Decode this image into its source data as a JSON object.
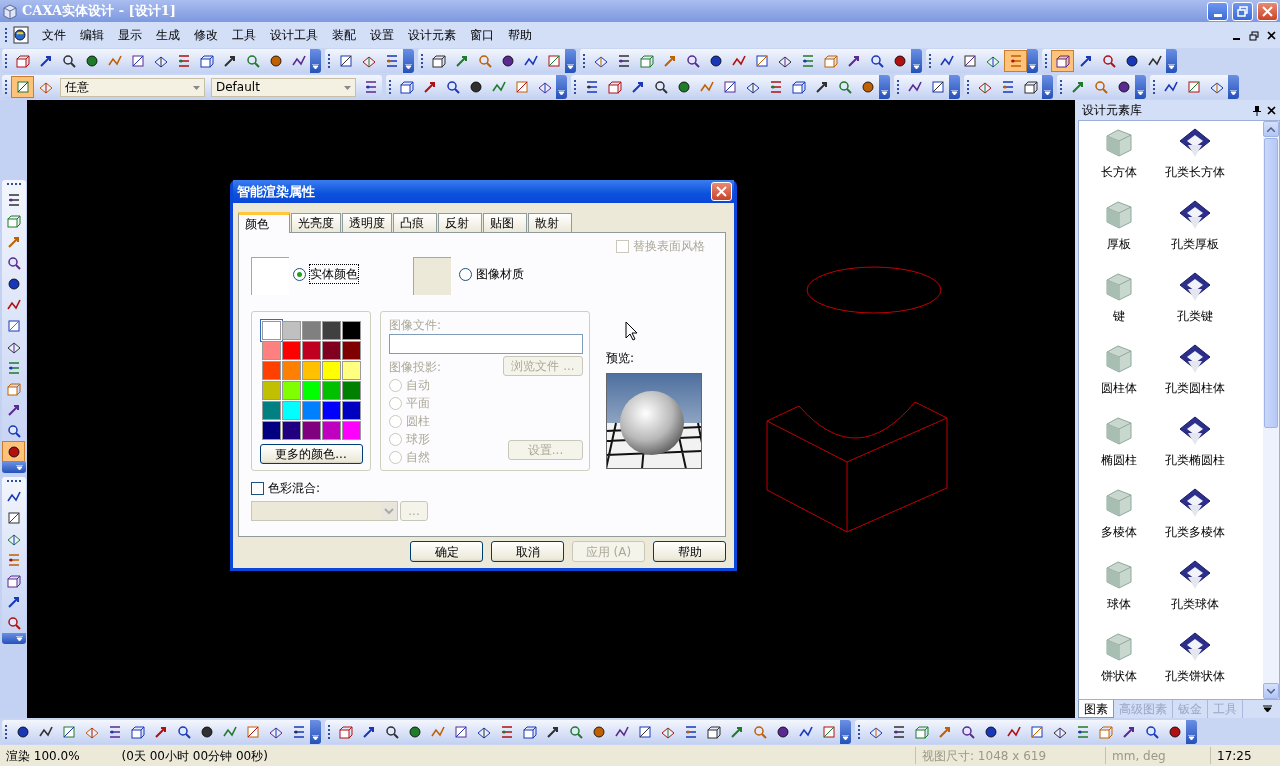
{
  "window": {
    "title": "CAXA实体设计 - [设计1]"
  },
  "menu": [
    "文件",
    "编辑",
    "显示",
    "生成",
    "修改",
    "工具",
    "设计工具",
    "装配",
    "设置",
    "设计元素",
    "窗口",
    "帮助"
  ],
  "toolbar_1": [
    {
      "buttons": [
        {
          "on": false
        },
        {
          "on": false
        },
        {
          "on": false
        },
        {
          "on": false
        },
        {
          "on": false
        },
        {
          "on": false
        },
        {
          "on": false
        },
        {
          "on": false
        },
        {
          "on": false
        },
        {
          "on": false
        },
        {
          "on": false
        },
        {
          "on": false
        },
        {
          "on": false
        }
      ]
    },
    {
      "buttons": [
        {
          "on": false
        },
        {
          "on": false
        },
        {
          "on": false
        }
      ]
    },
    {
      "buttons": [
        {
          "on": false
        },
        {
          "on": false
        },
        {
          "on": false
        },
        {
          "on": false
        },
        {
          "on": false
        },
        {
          "on": false
        }
      ]
    },
    {
      "buttons": [
        {
          "on": false
        },
        {
          "on": false
        },
        {
          "on": false
        },
        {
          "on": false
        },
        {
          "on": false
        },
        {
          "on": false
        },
        {
          "on": false
        },
        {
          "on": false
        },
        {
          "on": false
        },
        {
          "on": false
        },
        {
          "on": false
        },
        {
          "on": false
        },
        {
          "on": false
        },
        {
          "on": false
        }
      ]
    },
    {
      "buttons": [
        {
          "on": false
        },
        {
          "on": false
        },
        {
          "on": false
        },
        {
          "on": true
        }
      ]
    },
    {
      "buttons": [
        {
          "on": true
        },
        {
          "on": false
        },
        {
          "on": false
        },
        {
          "on": false
        },
        {
          "on": false
        }
      ]
    }
  ],
  "toolbar_2": {
    "start_buttons": [
      {
        "on": true
      },
      {
        "on": false
      }
    ],
    "selection_filter": "任意",
    "style": "Default",
    "end_buttons": [
      {
        "on": false
      }
    ],
    "groups": [
      {
        "buttons": [
          {
            "on": false
          },
          {
            "on": false
          },
          {
            "on": false
          },
          {
            "on": false
          },
          {
            "on": false
          },
          {
            "on": false
          },
          {
            "on": false
          }
        ]
      },
      {
        "buttons": [
          {
            "on": false
          },
          {
            "on": false
          },
          {
            "on": false
          },
          {
            "on": false
          },
          {
            "on": false
          },
          {
            "on": false
          },
          {
            "on": false
          },
          {
            "on": false
          },
          {
            "on": false
          },
          {
            "on": false
          },
          {
            "on": false
          },
          {
            "on": false
          },
          {
            "on": false
          }
        ]
      },
      {
        "buttons": [
          {
            "on": false
          },
          {
            "on": false
          }
        ]
      },
      {
        "buttons": [
          {
            "on": false
          },
          {
            "on": false
          },
          {
            "on": false
          }
        ]
      },
      {
        "buttons": [
          {
            "on": false
          },
          {
            "on": false
          },
          {
            "on": false
          }
        ]
      },
      {
        "buttons": [
          {
            "on": false
          },
          {
            "on": false
          },
          {
            "on": false
          }
        ]
      }
    ]
  },
  "left_toolbar": [
    {
      "buttons": [
        {
          "on": false
        },
        {
          "on": false
        },
        {
          "on": false
        },
        {
          "on": false
        },
        {
          "on": false
        },
        {
          "on": false
        },
        {
          "on": false
        },
        {
          "on": false
        },
        {
          "on": false
        },
        {
          "on": false
        },
        {
          "on": false
        },
        {
          "on": false
        },
        {
          "on": true
        }
      ]
    },
    {
      "buttons": [
        {
          "on": false
        },
        {
          "on": false
        },
        {
          "on": false
        },
        {
          "on": false
        },
        {
          "on": false
        },
        {
          "on": false
        },
        {
          "on": false
        }
      ]
    }
  ],
  "dialog": {
    "title": "智能渲染属性",
    "tabs": [
      {
        "label": "颜色",
        "selected": true
      },
      {
        "label": "光亮度",
        "selected": false
      },
      {
        "label": "透明度",
        "selected": false
      },
      {
        "label": "凸痕",
        "selected": false
      },
      {
        "label": "反射",
        "selected": false
      },
      {
        "label": "贴图",
        "selected": false
      },
      {
        "label": "散射",
        "selected": false
      }
    ],
    "replace_surface_style": {
      "label": "替换表面风格",
      "checked": false,
      "disabled": true
    },
    "color_source": [
      {
        "label": "实体颜色",
        "selected": true,
        "color": "#ffffff"
      },
      {
        "label": "图像材质",
        "selected": false,
        "color": "#ece9d8"
      }
    ],
    "palette": {
      "colors": [
        {
          "color": "#ffffff",
          "selected": true
        },
        {
          "color": "#c0c0c0",
          "selected": false
        },
        {
          "color": "#808080",
          "selected": false
        },
        {
          "color": "#404040",
          "selected": false
        },
        {
          "color": "#000000",
          "selected": false
        },
        {
          "color": "#ff8080",
          "selected": false
        },
        {
          "color": "#ff0000",
          "selected": false
        },
        {
          "color": "#c00020",
          "selected": false
        },
        {
          "color": "#800020",
          "selected": false
        },
        {
          "color": "#800000",
          "selected": false
        },
        {
          "color": "#ff4000",
          "selected": false
        },
        {
          "color": "#ff8000",
          "selected": false
        },
        {
          "color": "#ffc000",
          "selected": false
        },
        {
          "color": "#ffff00",
          "selected": false
        },
        {
          "color": "#ffff80",
          "selected": false
        },
        {
          "color": "#c0c000",
          "selected": false
        },
        {
          "color": "#80ff00",
          "selected": false
        },
        {
          "color": "#00ff00",
          "selected": false
        },
        {
          "color": "#00c000",
          "selected": false
        },
        {
          "color": "#008000",
          "selected": false
        },
        {
          "color": "#008080",
          "selected": false
        },
        {
          "color": "#00ffff",
          "selected": false
        },
        {
          "color": "#0080ff",
          "selected": false
        },
        {
          "color": "#0000ff",
          "selected": false
        },
        {
          "color": "#0000c0",
          "selected": false
        },
        {
          "color": "#000080",
          "selected": false
        },
        {
          "color": "#200080",
          "selected": false
        },
        {
          "color": "#800080",
          "selected": false
        },
        {
          "color": "#c000c0",
          "selected": false
        },
        {
          "color": "#ff00ff",
          "selected": false
        }
      ],
      "more_button": "更多的颜色..."
    },
    "image_group": {
      "disabled": true,
      "file_label": "图像文件:",
      "browse_button": "浏览文件 ...",
      "projection_label": "图像投影:",
      "projections": [
        {
          "label": "自动",
          "selected": false
        },
        {
          "label": "平面",
          "selected": false
        },
        {
          "label": "圆柱",
          "selected": false
        },
        {
          "label": "球形",
          "selected": false
        },
        {
          "label": "自然",
          "selected": false
        }
      ],
      "settings_button": "设置..."
    },
    "preview_label": "预览:",
    "color_blend": {
      "label": "色彩混合:",
      "checked": false,
      "select_disabled": true,
      "button": "...",
      "button_disabled": true
    },
    "buttons": [
      {
        "label": "确定",
        "disabled": false
      },
      {
        "label": "取消",
        "disabled": false
      },
      {
        "label": "应用 (A)",
        "disabled": true
      },
      {
        "label": "帮助",
        "disabled": false
      }
    ]
  },
  "design_library": {
    "title": "设计元素库",
    "items": [
      {
        "label": "长方体",
        "kind": "solid"
      },
      {
        "label": "孔类长方体",
        "kind": "hole"
      },
      {
        "label": "厚板",
        "kind": "solid"
      },
      {
        "label": "孔类厚板",
        "kind": "hole"
      },
      {
        "label": "键",
        "kind": "solid"
      },
      {
        "label": "孔类键",
        "kind": "hole"
      },
      {
        "label": "圆柱体",
        "kind": "solid"
      },
      {
        "label": "孔类圆柱体",
        "kind": "hole"
      },
      {
        "label": "椭圆柱",
        "kind": "solid"
      },
      {
        "label": "孔类椭圆柱",
        "kind": "hole"
      },
      {
        "label": "多棱体",
        "kind": "solid"
      },
      {
        "label": "孔类多棱体",
        "kind": "hole"
      },
      {
        "label": "球体",
        "kind": "solid"
      },
      {
        "label": "孔类球体",
        "kind": "hole"
      },
      {
        "label": "饼状体",
        "kind": "solid"
      },
      {
        "label": "孔类饼状体",
        "kind": "hole"
      }
    ],
    "tabs": [
      {
        "label": "图素",
        "selected": true
      },
      {
        "label": "高级图素",
        "selected": false
      },
      {
        "label": "钣金",
        "selected": false
      },
      {
        "label": "工具",
        "selected": false
      }
    ]
  },
  "bottom_toolbar": [
    {
      "buttons": [
        {
          "on": false
        },
        {
          "on": false
        },
        {
          "on": false
        },
        {
          "on": false
        },
        {
          "on": false
        },
        {
          "on": false
        },
        {
          "on": false
        },
        {
          "on": false
        },
        {
          "on": false
        },
        {
          "on": false
        },
        {
          "on": false
        },
        {
          "on": false
        },
        {
          "on": false
        }
      ]
    },
    {
      "buttons": [
        {
          "on": false
        },
        {
          "on": false
        },
        {
          "on": false
        },
        {
          "on": false
        },
        {
          "on": false
        },
        {
          "on": false
        },
        {
          "on": false
        },
        {
          "on": false
        },
        {
          "on": false
        },
        {
          "on": false
        },
        {
          "on": false
        },
        {
          "on": false
        },
        {
          "on": false
        },
        {
          "on": false
        },
        {
          "on": false
        },
        {
          "on": false
        },
        {
          "on": false
        },
        {
          "on": false
        },
        {
          "on": false
        },
        {
          "on": false
        },
        {
          "on": false
        },
        {
          "on": false
        }
      ]
    },
    {
      "buttons": [
        {
          "on": false
        },
        {
          "on": false
        },
        {
          "on": false
        },
        {
          "on": false
        },
        {
          "on": false
        },
        {
          "on": false
        },
        {
          "on": false
        },
        {
          "on": false
        },
        {
          "on": false
        },
        {
          "on": false
        },
        {
          "on": false
        },
        {
          "on": false
        },
        {
          "on": false
        },
        {
          "on": false
        }
      ]
    }
  ],
  "status_bar": {
    "render": "渲染 100.0%",
    "elapsed": "(0天 00小时 00分钟 00秒)",
    "view_size": "视图尺寸: 1048 x 619",
    "units": "mm, deg",
    "time": "17:25"
  }
}
